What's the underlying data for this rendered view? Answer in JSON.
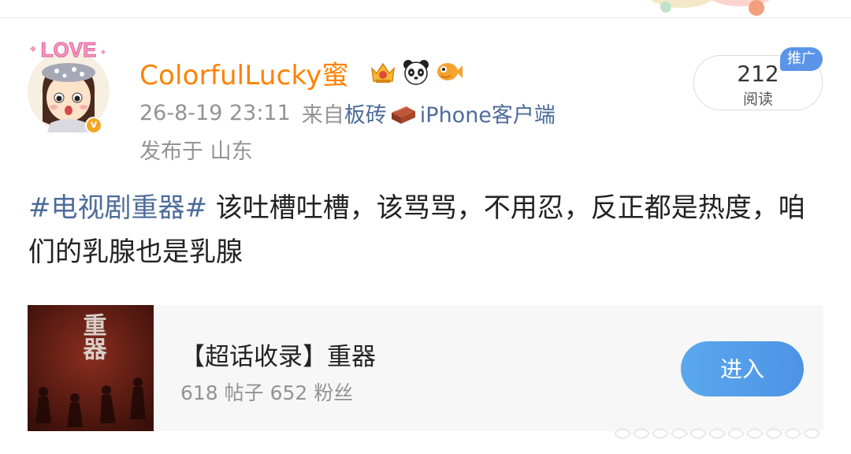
{
  "post": {
    "username": "ColorfulLucky蜜",
    "timestamp": "26-8-19 23:11",
    "source_prefix": "来自",
    "source_app_1": "板砖",
    "source_app_2": "iPhone客户端",
    "location": "发布于 山东",
    "hashtag": "#电视剧重器#",
    "body": " 该吐槽吐槽，该骂骂，不用忍，反正都是热度，咱们的乳腺也是乳腺",
    "avatar_text": "LOVE",
    "badges": [
      "crown-badge-icon",
      "panda-icon",
      "fish-icon"
    ]
  },
  "read_pill": {
    "count": "212",
    "label": "阅读",
    "promo_tag": "推广"
  },
  "card": {
    "thumb_title": "重器",
    "title": "【超话收录】重器",
    "stats": "618 帖子 652 粉丝",
    "enter_label": "进入"
  },
  "colors": {
    "username": "#ff8200",
    "link": "#4d6c9a",
    "meta": "#939393",
    "button": "#4d93e6",
    "promo": "#5b95ea"
  }
}
